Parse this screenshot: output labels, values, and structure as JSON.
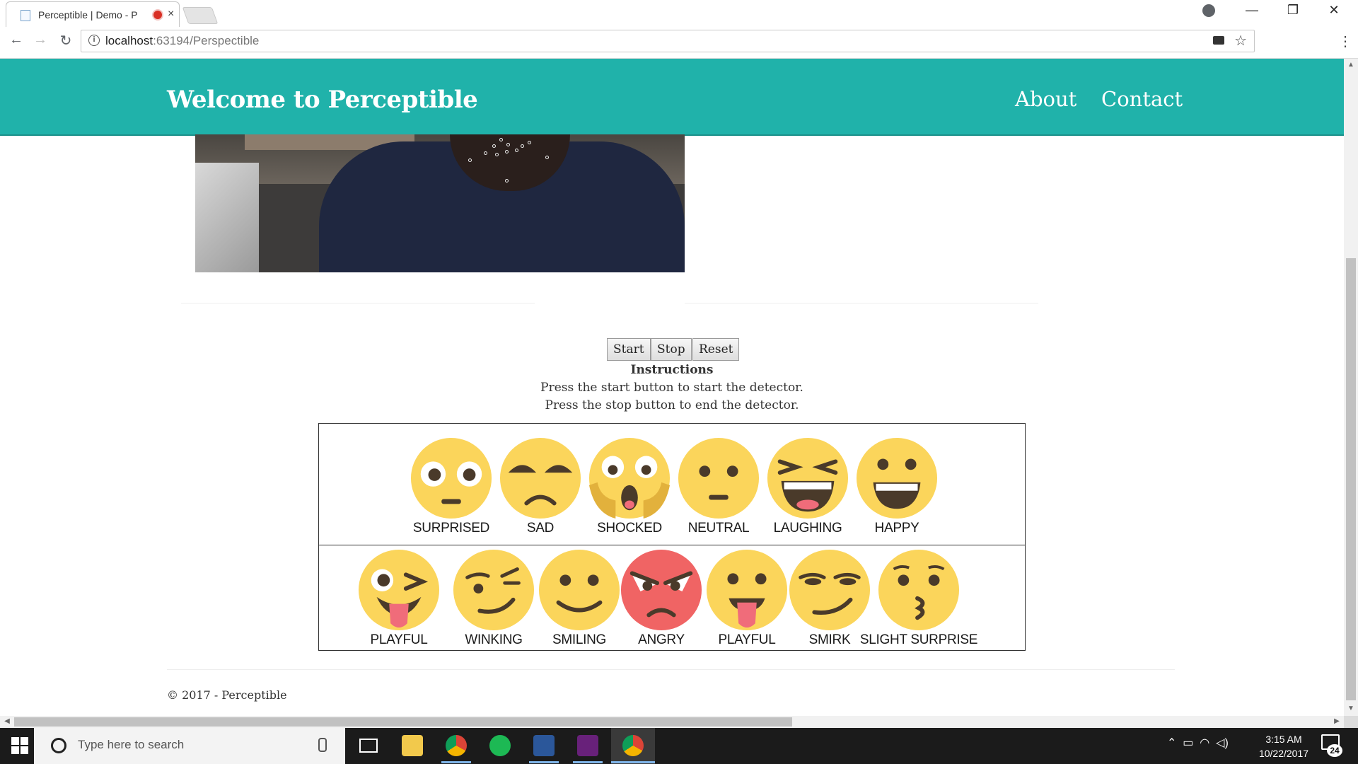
{
  "browser": {
    "tab_title": "Perceptible | Demo - P",
    "tab_close": "×",
    "back": "←",
    "forward": "→",
    "reload": "↻",
    "info": "i",
    "url_host": "localhost",
    "url_rest": ":63194/Perspectible",
    "star": "☆",
    "menu": "⋮",
    "minimize": "—",
    "maximize": "❐",
    "close": "✕"
  },
  "header": {
    "brand": "Welcome to Perceptible",
    "nav": [
      {
        "label": "About"
      },
      {
        "label": "Contact"
      }
    ],
    "bg_color": "#20b2aa"
  },
  "controls": {
    "start": "Start",
    "stop": "Stop",
    "reset": "Reset"
  },
  "instructions": {
    "title": "Instructions",
    "line1": "Press the start button to start the detector.",
    "line2": "Press the stop button to end the detector."
  },
  "emotions": {
    "row1": [
      {
        "label": "SURPRISED",
        "type": "surprised"
      },
      {
        "label": "SAD",
        "type": "sad"
      },
      {
        "label": "SHOCKED",
        "type": "shocked"
      },
      {
        "label": "NEUTRAL",
        "type": "neutral"
      },
      {
        "label": "LAUGHING",
        "type": "laughing"
      },
      {
        "label": "HAPPY",
        "type": "happy"
      }
    ],
    "row2": [
      {
        "label": "PLAYFUL",
        "type": "playful-wink"
      },
      {
        "label": "WINKING",
        "type": "winking"
      },
      {
        "label": "SMILING",
        "type": "smiling"
      },
      {
        "label": "ANGRY",
        "type": "angry"
      },
      {
        "label": "PLAYFUL",
        "type": "playful"
      },
      {
        "label": "SMIRK",
        "type": "smirk"
      },
      {
        "label": "SLIGHT SURPRISE",
        "type": "slight-surprise"
      }
    ],
    "face_color": "#fbd55b",
    "angry_color": "#f06464"
  },
  "footer": {
    "copyright": "© 2017 - Perceptible"
  },
  "taskbar": {
    "search_placeholder": "Type here to search",
    "time": "3:15 AM",
    "date": "10/22/2017",
    "notifications": "24"
  }
}
